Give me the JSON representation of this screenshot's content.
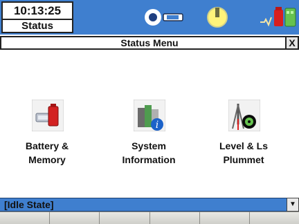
{
  "topbar": {
    "time": "10:13:25",
    "mode_label": "Status",
    "icons": [
      "prism-target-icon",
      "compass-light-icon",
      "battery-memory-status-icon"
    ]
  },
  "titlebar": {
    "title": "Status Menu",
    "close_label": "X"
  },
  "menu": [
    {
      "line1": "Battery &",
      "line2": "Memory",
      "icon": "battery-icon"
    },
    {
      "line1": "System",
      "line2": "Information",
      "icon": "system-info-icon"
    },
    {
      "line1": "Level & Ls",
      "line2": "Plummet",
      "icon": "level-plummet-icon"
    }
  ],
  "statusbar": {
    "text": "[Idle State]",
    "scroll_label": "▼"
  },
  "softkeys": [
    "",
    "",
    "",
    "",
    "",
    ""
  ],
  "colors": {
    "accent_blue": "#3f7fcf",
    "background": "#ffffff"
  }
}
